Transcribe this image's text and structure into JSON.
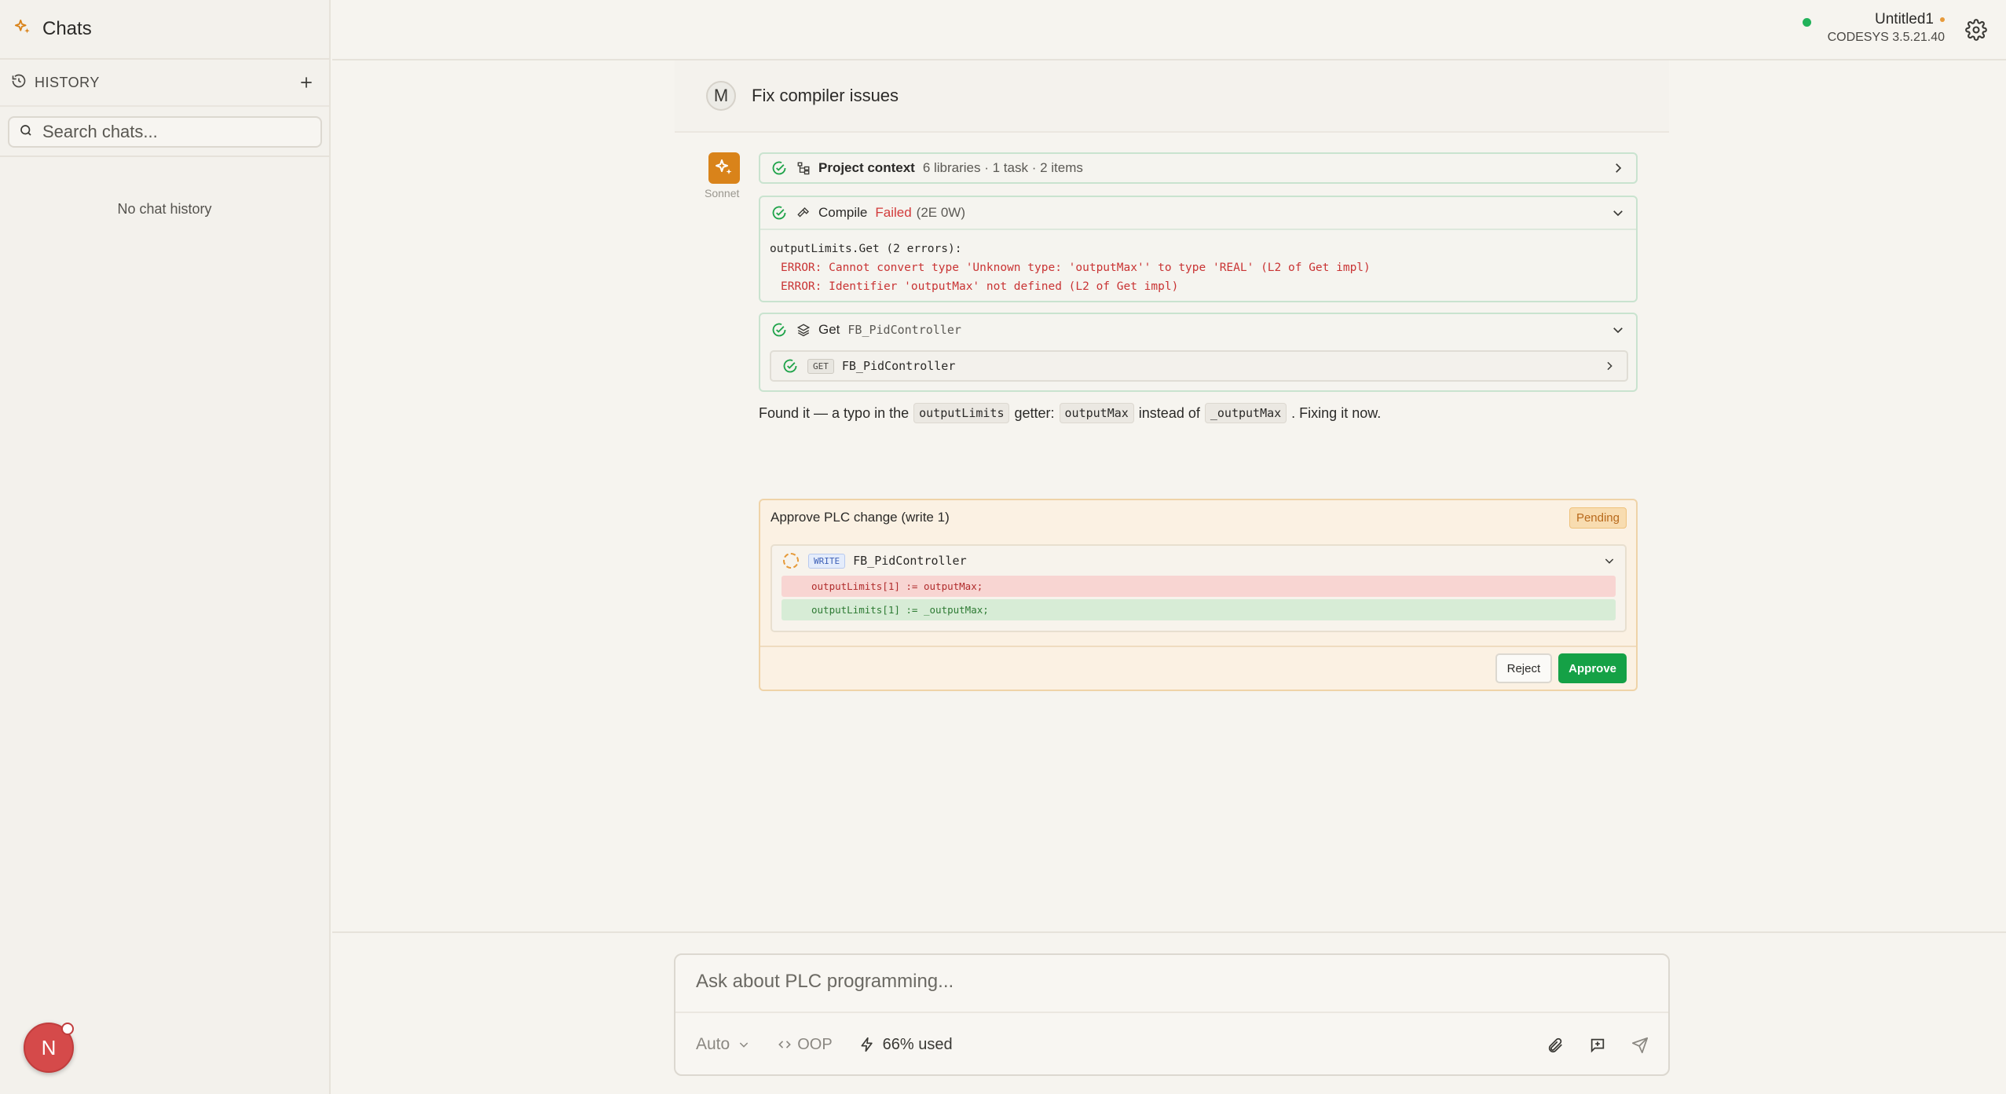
{
  "sidebar": {
    "title": "Chats",
    "history_label": "HISTORY",
    "search_placeholder": "Search chats...",
    "empty_text": "No chat history",
    "user_initial": "N"
  },
  "topbar": {
    "project_name": "Untitled1",
    "version": "CODESYS 3.5.21.40",
    "connection_color": "#22b25a"
  },
  "conversation": {
    "user_initial": "M",
    "user_message": "Fix compiler issues",
    "model_label": "Sonnet",
    "project_context": {
      "name": "Project context",
      "meta": "6 libraries · 1 task · 2 items"
    },
    "compile": {
      "name": "Compile",
      "status": "Failed",
      "counts": "(2E 0W)",
      "output_header": "outputLimits.Get (2 errors):",
      "errors": [
        "ERROR: Cannot convert type 'Unknown type: 'outputMax'' to type 'REAL' (L2 of Get impl)",
        "ERROR: Identifier 'outputMax' not defined (L2 of Get impl)"
      ]
    },
    "get_tool": {
      "name": "Get",
      "target": "FB_PidController",
      "inner_tag": "GET",
      "inner_target": "FB_PidController"
    },
    "explanation": {
      "part1": "Found it — a typo in the",
      "code1": "outputLimits",
      "part2": "getter:",
      "code2": "outputMax",
      "part3": "instead of",
      "code3": "_outputMax",
      "part4": ". Fixing it now."
    },
    "approval": {
      "title": "Approve PLC change (write 1)",
      "status": "Pending",
      "write_tag": "WRITE",
      "write_target": "FB_PidController",
      "diff_removed": "outputLimits[1] := outputMax;",
      "diff_added": "outputLimits[1] := _outputMax;",
      "reject_label": "Reject",
      "approve_label": "Approve"
    }
  },
  "composer": {
    "placeholder": "Ask about PLC programming...",
    "model": "Auto",
    "mode": "OOP",
    "usage": "66% used"
  },
  "colors": {
    "accent": "#d9831a",
    "success": "#15a146",
    "error": "#d23a3a",
    "pending": "#b8691b"
  }
}
